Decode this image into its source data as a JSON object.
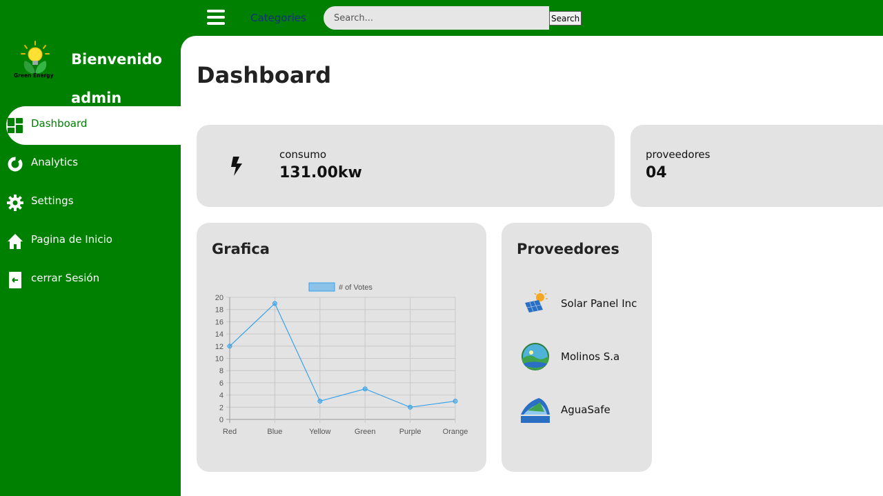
{
  "topbar": {
    "categories_label": "Categories",
    "search_placeholder": "Search...",
    "search_button": "Search"
  },
  "sidebar": {
    "logo_text": "Green Energy",
    "welcome_line1": "Bienvenido",
    "welcome_line2": "admin",
    "items": [
      {
        "label": "Dashboard",
        "icon": "dashboard-grid-icon",
        "active": true
      },
      {
        "label": "Analytics",
        "icon": "donut-chart-icon",
        "active": false
      },
      {
        "label": "Settings",
        "icon": "gear-icon",
        "active": false
      },
      {
        "label": "Pagina de Inicio",
        "icon": "home-icon",
        "active": false
      },
      {
        "label": "cerrar Sesión",
        "icon": "logout-icon",
        "active": false
      }
    ]
  },
  "main": {
    "title": "Dashboard",
    "stats": [
      {
        "label": "consumo",
        "value": "131.00kw",
        "icon": "lightning-icon"
      },
      {
        "label": "proveedores",
        "value": "04"
      }
    ],
    "chart_card_title": "Grafica",
    "providers_title": "Proveedores",
    "providers": [
      {
        "name": "Solar Panel Inc",
        "icon": "solar-panel-logo"
      },
      {
        "name": "Molinos S.a",
        "icon": "molinos-logo"
      },
      {
        "name": "AguaSafe",
        "icon": "aguasafe-logo"
      }
    ]
  },
  "colors": {
    "primary_green": "#008000",
    "card_bg": "#e3e3e3",
    "line": "#36a2eb"
  },
  "chart_data": {
    "type": "line",
    "categories": [
      "Red",
      "Blue",
      "Yellow",
      "Green",
      "Purple",
      "Orange"
    ],
    "series": [
      {
        "name": "# of Votes",
        "values": [
          12,
          19,
          3,
          5,
          2,
          3
        ]
      }
    ],
    "ylim": [
      0,
      20
    ],
    "yticks": [
      0,
      2,
      4,
      6,
      8,
      10,
      12,
      14,
      16,
      18,
      20
    ],
    "legend": "top",
    "grid": true
  }
}
